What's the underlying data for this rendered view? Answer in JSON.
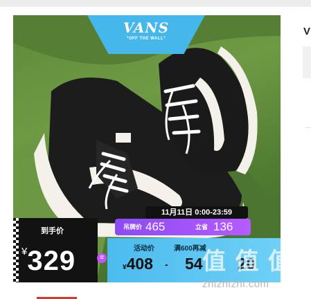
{
  "product_image": {
    "brand_logo": "VANS",
    "brand_tagline": "\"OFF THE WALL\"",
    "sale_period": "11月11日 0:00-23:59",
    "tag_price_label": "吊牌价",
    "tag_price": "465",
    "coupon_label": "立省",
    "coupon_value": "136",
    "final_price_label": "到手价",
    "currency": "¥",
    "final_price": "329",
    "equals_symbol": "=",
    "promo_price_label": "活动价",
    "promo_price": "408",
    "minus_symbol": "-",
    "discount_label": "满600再减",
    "discount_value": "54",
    "third_value": "20"
  },
  "watermark": {
    "text": "值 值 值",
    "url": "zhizhizhi.com"
  },
  "right_panel": {
    "title_fragment": "V"
  },
  "colors": {
    "banner_blue": "#45b7ea",
    "promo_purple": "#a35cff",
    "accent_red": "#d9362b"
  }
}
